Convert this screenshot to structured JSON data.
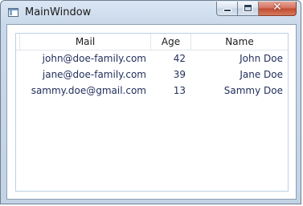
{
  "window": {
    "title": "MainWindow",
    "close_glyph": "✕"
  },
  "listview": {
    "columns": [
      "Mail",
      "Age",
      "Name"
    ],
    "rows": [
      {
        "mail": "john@doe-family.com",
        "age": "42",
        "name": "John Doe"
      },
      {
        "mail": "jane@doe-family.com",
        "age": "39",
        "name": "Jane Doe"
      },
      {
        "mail": "sammy.doe@gmail.com",
        "age": "13",
        "name": "Sammy Doe"
      }
    ]
  },
  "icons": {
    "app": "window-app-icon",
    "minimize": "minimize-icon",
    "maximize": "maximize-icon",
    "close": "close-icon"
  },
  "colors": {
    "titlebar": "#c9d8ea",
    "close_button": "#c0492f",
    "row_text": "#1f2d5a",
    "list_border": "#bcd0e3"
  }
}
